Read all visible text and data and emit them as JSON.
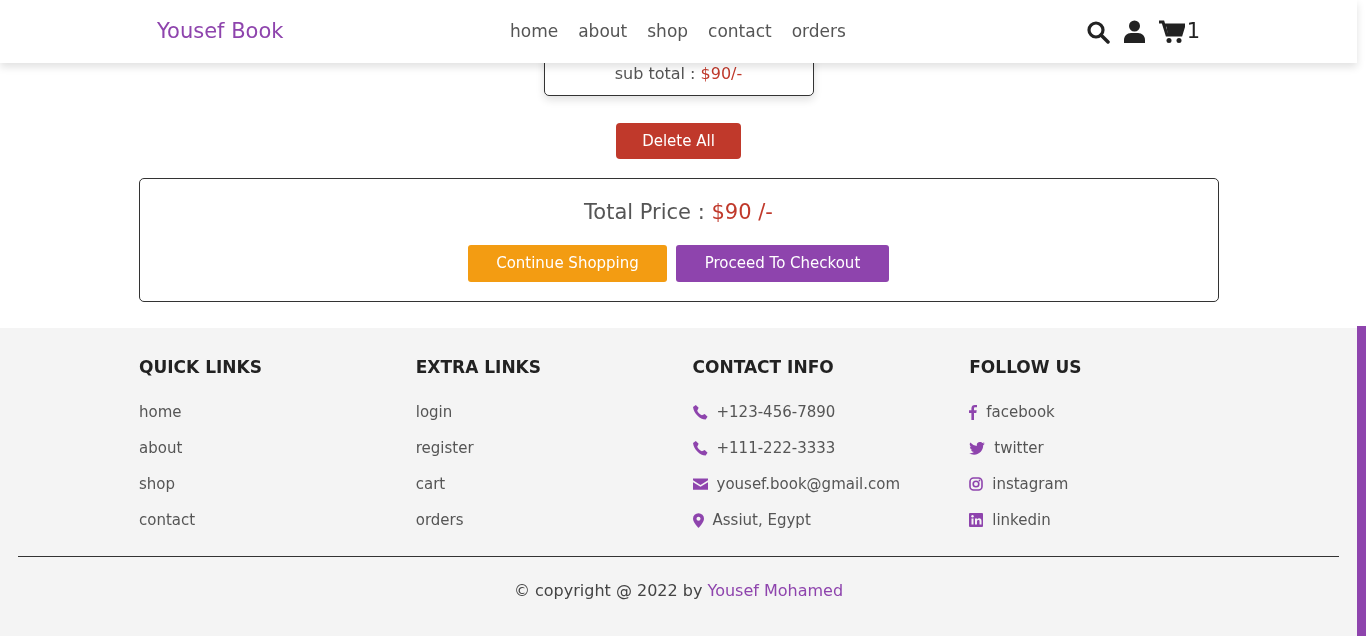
{
  "header": {
    "logo": "Yousef Book",
    "nav": [
      "home",
      "about",
      "shop",
      "contact",
      "orders"
    ],
    "cart_count": "1"
  },
  "cart_item": {
    "label": "sub total : ",
    "value": "$90/-"
  },
  "delete_all": "Delete All",
  "total": {
    "label": "Total Price : ",
    "value": "$90 /-",
    "buttons": [
      {
        "label": "Continue Shopping",
        "kind": "orange"
      },
      {
        "label": "Proceed To Checkout",
        "kind": "purple"
      }
    ]
  },
  "footer": {
    "columns": [
      {
        "title": "QUICK LINKS",
        "items": [
          {
            "label": "home"
          },
          {
            "label": "about"
          },
          {
            "label": "shop"
          },
          {
            "label": "contact"
          }
        ]
      },
      {
        "title": "EXTRA LINKS",
        "items": [
          {
            "label": "login"
          },
          {
            "label": "register"
          },
          {
            "label": "cart"
          },
          {
            "label": "orders"
          }
        ]
      },
      {
        "title": "CONTACT INFO",
        "items": [
          {
            "label": "+123-456-7890",
            "kind": "phone"
          },
          {
            "label": "+111-222-3333",
            "kind": "phone"
          },
          {
            "label": "yousef.book@gmail.com",
            "kind": "envelope"
          },
          {
            "label": "Assiut, Egypt",
            "kind": "pin"
          }
        ]
      },
      {
        "title": "FOLLOW US",
        "items": [
          {
            "label": "facebook",
            "kind": "facebook"
          },
          {
            "label": "twitter",
            "kind": "twitter"
          },
          {
            "label": "instagram",
            "kind": "instagram"
          },
          {
            "label": "linkedin",
            "kind": "linkedin"
          }
        ]
      }
    ],
    "copyright": "© copyright @ 2022 by ",
    "author": "Yousef Mohamed"
  }
}
